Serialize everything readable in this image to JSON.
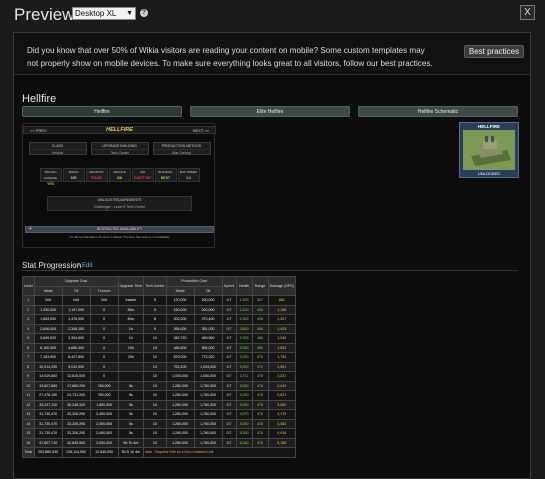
{
  "header": {
    "title": "Preview",
    "device_select": "Desktop XL",
    "help_glyph": "?",
    "close_glyph": "X"
  },
  "banner": {
    "text": "Did you know that over 50% of Wikia visitors are reading your content on mobile? Some custom templates may not properly show on mobile devices. To make sure everything looks great to all visitors, follow our best practices.",
    "button": "Best practices"
  },
  "page": {
    "title": "Hellfire",
    "tabs": [
      "Hellfire",
      "Elite Hellfire",
      "Hellfire Schematic"
    ]
  },
  "infobox": {
    "prev": "<< PREV",
    "name": "HELLFIRE",
    "next": "NEXT >>",
    "class_h": "CLASS",
    "class_v": "Vehicle",
    "upgrade_h": "UPGRADE BUILDING",
    "upgrade_v": "Tech Center",
    "production_h": "PRODUCTION METHOD",
    "production_v": "War Factory",
    "stats": [
      {
        "h": "SPLASH DAMAGE",
        "v": "YES",
        "c": "#7fd94a"
      },
      {
        "h": "SPACE",
        "v": "150",
        "c": "#cccccc"
      },
      {
        "h": "INFANTRY",
        "v": "POOR",
        "c": "#e0483a"
      },
      {
        "h": "VEHICLE",
        "v": "OK",
        "c": "#e6c85a"
      },
      {
        "h": "AIR",
        "v": "CAN'T HIT",
        "c": "#e0483a"
      },
      {
        "h": "BUILDING",
        "v": "BEST",
        "c": "#7fd94a"
      },
      {
        "h": "MAP SPEED",
        "v": "1.1",
        "c": "#cccccc"
      }
    ],
    "unlock_h": "UNLOCK REQUIREMENTS",
    "unlock_v": "Challenger - Level 5 Tech Center",
    "restricted": "RESTRICTED AVAILABILITY",
    "footnote": "For More Information On How to Obtain This Item See History of Availability",
    "plus": "+"
  },
  "unit_card": {
    "name": "HELLFIRE",
    "label": "UNLOCKED"
  },
  "stat_section": {
    "title": "Stat Progression",
    "edit": "Edit"
  },
  "table": {
    "top_headers": [
      "Level",
      "Upgrade Cost",
      "Upgrade Time",
      "Tech Center",
      "Production Cost",
      "Speed",
      "Health",
      "Range",
      "Damage (DPS)"
    ],
    "sub_headers": [
      "Metal",
      "Oil",
      "Thorium",
      "Metal",
      "Oil"
    ],
    "rows": [
      [
        "1",
        "N/A",
        "N/A",
        "N/A",
        "Instant",
        "5",
        "120,000",
        "160,000",
        "0.7",
        "1,900",
        "327",
        "882"
      ],
      [
        "2",
        "1,330,000",
        "1,197,000",
        "0",
        "30m",
        "5",
        "150,000",
        "200,000",
        "0.7",
        "2,100",
        "405",
        "1,158"
      ],
      [
        "3",
        "1,663,000",
        "1,476,000",
        "0",
        "40m",
        "8",
        "202,000",
        "270,400",
        "0.7",
        "2,300",
        "426",
        "1,207"
      ],
      [
        "4",
        "2,606,000",
        "2,345,100",
        "0",
        "1h",
        "9",
        "265,000",
        "351,020",
        "0.7",
        "2,600",
        "446",
        "1,425"
      ],
      [
        "5",
        "3,849,020",
        "3,334,600",
        "0",
        "1h",
        "10",
        "342,720",
        "469,960",
        "0.7",
        "2,700",
        "468",
        "1,545"
      ],
      [
        "6",
        "6,100,000",
        "4,680,400",
        "0",
        "10h",
        "10",
        "446,600",
        "594,000",
        "0.7",
        "2,900",
        "489",
        "1,663"
      ],
      [
        "7",
        "7,163,900",
        "6,427,800",
        "0",
        "20h",
        "10",
        "579,000",
        "772,320",
        "0.7",
        "3,100",
        "470",
        "1,752"
      ],
      [
        "8",
        "10,014,200",
        "9,012,900",
        "0",
        "",
        "10",
        "753,100",
        "1,004,000",
        "0.7",
        "3,300",
        "472",
        "1,901"
      ],
      [
        "9",
        "14,019,800",
        "12,615,000",
        "0",
        "",
        "10",
        "1,000,000",
        "1,000,000",
        "0.7",
        "3,711",
        "478",
        "2,221"
      ],
      [
        "10",
        "19,627,600",
        "17,660,200",
        "780,000",
        "5s",
        "10",
        "1,260,000",
        "1,760,000",
        "0.7",
        "3,900",
        "476",
        "2,410"
      ],
      [
        "11",
        "27,478,190",
        "24,731,200",
        "780,000",
        "5s",
        "10",
        "1,260,000",
        "1,760,000",
        "0.7",
        "4,200",
        "476",
        "2,621"
      ],
      [
        "12",
        "33,227,110",
        "30,248,320",
        "1,800,000",
        "5s",
        "10",
        "1,260,000",
        "1,760,000",
        "0.7",
        "4,500",
        "476",
        "3,062"
      ],
      [
        "13",
        "31,730,470",
        "33,326,290",
        "2,400,000",
        "5s",
        "10",
        "1,260,000",
        "1,760,000",
        "0.7",
        "4,570",
        "476",
        "4,175"
      ],
      [
        "14",
        "31,730,470",
        "33,326,290",
        "2,400,000",
        "5s",
        "10",
        "1,260,000",
        "1,760,000",
        "0.7",
        "4,900",
        "476",
        "4,484"
      ],
      [
        "15",
        "31,730,470",
        "33,326,290",
        "2,400,000",
        "5s",
        "10",
        "1,260,000",
        "1,760,000",
        "0.7",
        "5,500",
        "476",
        "4,916"
      ],
      [
        "16",
        "47,607,710",
        "42,845,900",
        "3,000,000",
        "5d 7h 4m",
        "10",
        "1,260,000",
        "1,760,000",
        "0.7",
        "6,240",
        "476",
        "5,156"
      ]
    ],
    "total_label": "Total",
    "totals": [
      "253,860,930",
      "228,114,900",
      "12,840,000",
      "50 D 1h 4m"
    ],
    "note": "Note - Requires Path for a Non-Combined Unit"
  }
}
